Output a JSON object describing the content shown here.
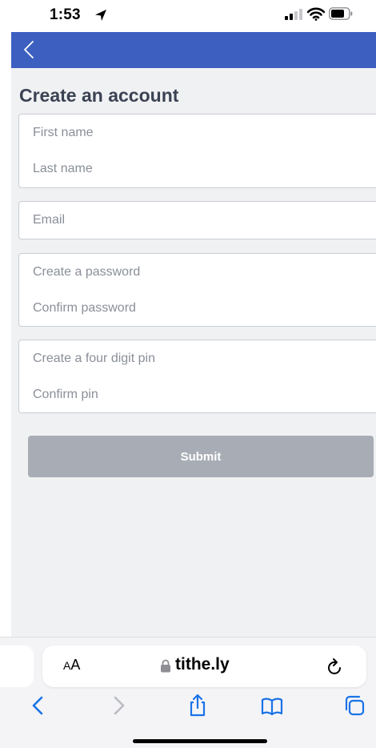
{
  "status_bar": {
    "time": "1:53"
  },
  "nav": {
    "back_icon": "chevron-left-icon"
  },
  "form": {
    "title": "Create an account",
    "first_name_placeholder": "First name",
    "last_name_placeholder": "Last name",
    "email_placeholder": "Email",
    "password_placeholder": "Create a password",
    "confirm_password_placeholder": "Confirm password",
    "pin_placeholder": "Create a four digit pin",
    "confirm_pin_placeholder": "Confirm pin",
    "submit_label": "Submit"
  },
  "browser": {
    "aa_label_small": "A",
    "aa_label_large": "A",
    "url": "tithe.ly"
  },
  "colors": {
    "nav_bar": "#3c5fc0",
    "content_bg": "#f0f1f3",
    "submit_disabled": "#a8adb5",
    "title_text": "#3b4252",
    "safari_accent": "#1a73e8"
  }
}
